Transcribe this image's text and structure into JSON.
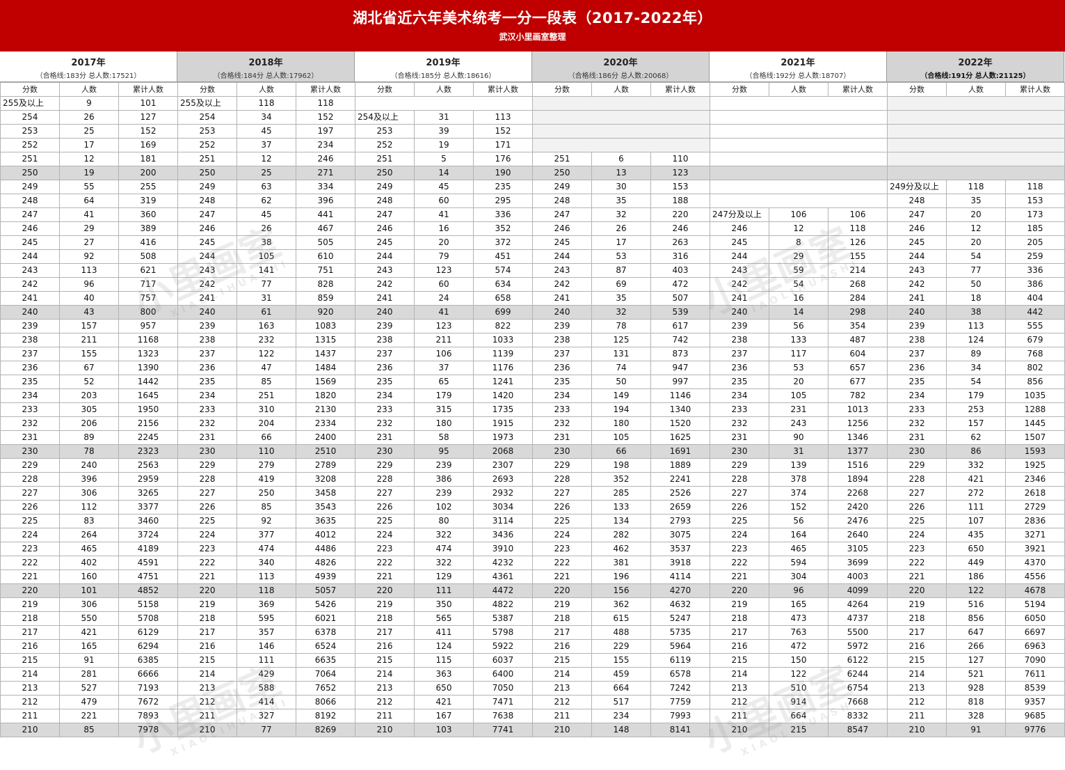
{
  "title": "湖北省近六年美术统考一分一段表（2017-2022年）",
  "subtitle": "武汉小里画室整理",
  "watermark": {
    "main": "小里画室",
    "sub": "XIAOLIHUASHI"
  },
  "years": [
    {
      "year": "2017年",
      "stat": "（合格线:183分 总人数:17521）",
      "grey": false,
      "bold": false
    },
    {
      "year": "2018年",
      "stat": "（合格线:184分 总人数:17962）",
      "grey": true,
      "bold": false
    },
    {
      "year": "2019年",
      "stat": "（合格线:185分 总人数:18616）",
      "grey": false,
      "bold": false
    },
    {
      "year": "2020年",
      "stat": "（合格线:186分 总人数:20068）",
      "grey": true,
      "bold": false
    },
    {
      "year": "2021年",
      "stat": "（合格线:192分 总人数:18707）",
      "grey": false,
      "bold": false
    },
    {
      "year": "2022年",
      "stat": "（合格线:191分 总人数:21125）",
      "grey": true,
      "bold": true
    }
  ],
  "col_headers": [
    "分数",
    "人数",
    "累计人数"
  ],
  "rows": [
    [
      "255及以上",
      "9",
      "101",
      "255及以上",
      "118",
      "118",
      "",
      "",
      "",
      "",
      "",
      "",
      "",
      "",
      "",
      "",
      "",
      ""
    ],
    [
      "254",
      "26",
      "127",
      "254",
      "34",
      "152",
      "254及以上",
      "31",
      "113",
      "",
      "",
      "",
      "",
      "",
      "",
      "",
      "",
      ""
    ],
    [
      "253",
      "25",
      "152",
      "253",
      "45",
      "197",
      "253",
      "39",
      "152",
      "",
      "",
      "",
      "",
      "",
      "",
      "",
      "",
      ""
    ],
    [
      "252",
      "17",
      "169",
      "252",
      "37",
      "234",
      "252",
      "19",
      "171",
      "",
      "",
      "",
      "",
      "",
      "",
      "",
      "",
      ""
    ],
    [
      "251",
      "12",
      "181",
      "251",
      "12",
      "246",
      "251",
      "5",
      "176",
      "251",
      "6",
      "110",
      "",
      "",
      "",
      "",
      "",
      ""
    ],
    [
      "250",
      "19",
      "200",
      "250",
      "25",
      "271",
      "250",
      "14",
      "190",
      "250",
      "13",
      "123",
      "",
      "",
      "",
      "",
      "",
      ""
    ],
    [
      "249",
      "55",
      "255",
      "249",
      "63",
      "334",
      "249",
      "45",
      "235",
      "249",
      "30",
      "153",
      "",
      "",
      "",
      "249分及以上",
      "118",
      "118"
    ],
    [
      "248",
      "64",
      "319",
      "248",
      "62",
      "396",
      "248",
      "60",
      "295",
      "248",
      "35",
      "188",
      "",
      "",
      "",
      "248",
      "35",
      "153"
    ],
    [
      "247",
      "41",
      "360",
      "247",
      "45",
      "441",
      "247",
      "41",
      "336",
      "247",
      "32",
      "220",
      "247分及以上",
      "106",
      "106",
      "247",
      "20",
      "173"
    ],
    [
      "246",
      "29",
      "389",
      "246",
      "26",
      "467",
      "246",
      "16",
      "352",
      "246",
      "26",
      "246",
      "246",
      "12",
      "118",
      "246",
      "12",
      "185"
    ],
    [
      "245",
      "27",
      "416",
      "245",
      "38",
      "505",
      "245",
      "20",
      "372",
      "245",
      "17",
      "263",
      "245",
      "8",
      "126",
      "245",
      "20",
      "205"
    ],
    [
      "244",
      "92",
      "508",
      "244",
      "105",
      "610",
      "244",
      "79",
      "451",
      "244",
      "53",
      "316",
      "244",
      "29",
      "155",
      "244",
      "54",
      "259"
    ],
    [
      "243",
      "113",
      "621",
      "243",
      "141",
      "751",
      "243",
      "123",
      "574",
      "243",
      "87",
      "403",
      "243",
      "59",
      "214",
      "243",
      "77",
      "336"
    ],
    [
      "242",
      "96",
      "717",
      "242",
      "77",
      "828",
      "242",
      "60",
      "634",
      "242",
      "69",
      "472",
      "242",
      "54",
      "268",
      "242",
      "50",
      "386"
    ],
    [
      "241",
      "40",
      "757",
      "241",
      "31",
      "859",
      "241",
      "24",
      "658",
      "241",
      "35",
      "507",
      "241",
      "16",
      "284",
      "241",
      "18",
      "404"
    ],
    [
      "240",
      "43",
      "800",
      "240",
      "61",
      "920",
      "240",
      "41",
      "699",
      "240",
      "32",
      "539",
      "240",
      "14",
      "298",
      "240",
      "38",
      "442"
    ],
    [
      "239",
      "157",
      "957",
      "239",
      "163",
      "1083",
      "239",
      "123",
      "822",
      "239",
      "78",
      "617",
      "239",
      "56",
      "354",
      "239",
      "113",
      "555"
    ],
    [
      "238",
      "211",
      "1168",
      "238",
      "232",
      "1315",
      "238",
      "211",
      "1033",
      "238",
      "125",
      "742",
      "238",
      "133",
      "487",
      "238",
      "124",
      "679"
    ],
    [
      "237",
      "155",
      "1323",
      "237",
      "122",
      "1437",
      "237",
      "106",
      "1139",
      "237",
      "131",
      "873",
      "237",
      "117",
      "604",
      "237",
      "89",
      "768"
    ],
    [
      "236",
      "67",
      "1390",
      "236",
      "47",
      "1484",
      "236",
      "37",
      "1176",
      "236",
      "74",
      "947",
      "236",
      "53",
      "657",
      "236",
      "34",
      "802"
    ],
    [
      "235",
      "52",
      "1442",
      "235",
      "85",
      "1569",
      "235",
      "65",
      "1241",
      "235",
      "50",
      "997",
      "235",
      "20",
      "677",
      "235",
      "54",
      "856"
    ],
    [
      "234",
      "203",
      "1645",
      "234",
      "251",
      "1820",
      "234",
      "179",
      "1420",
      "234",
      "149",
      "1146",
      "234",
      "105",
      "782",
      "234",
      "179",
      "1035"
    ],
    [
      "233",
      "305",
      "1950",
      "233",
      "310",
      "2130",
      "233",
      "315",
      "1735",
      "233",
      "194",
      "1340",
      "233",
      "231",
      "1013",
      "233",
      "253",
      "1288"
    ],
    [
      "232",
      "206",
      "2156",
      "232",
      "204",
      "2334",
      "232",
      "180",
      "1915",
      "232",
      "180",
      "1520",
      "232",
      "243",
      "1256",
      "232",
      "157",
      "1445"
    ],
    [
      "231",
      "89",
      "2245",
      "231",
      "66",
      "2400",
      "231",
      "58",
      "1973",
      "231",
      "105",
      "1625",
      "231",
      "90",
      "1346",
      "231",
      "62",
      "1507"
    ],
    [
      "230",
      "78",
      "2323",
      "230",
      "110",
      "2510",
      "230",
      "95",
      "2068",
      "230",
      "66",
      "1691",
      "230",
      "31",
      "1377",
      "230",
      "86",
      "1593"
    ],
    [
      "229",
      "240",
      "2563",
      "229",
      "279",
      "2789",
      "229",
      "239",
      "2307",
      "229",
      "198",
      "1889",
      "229",
      "139",
      "1516",
      "229",
      "332",
      "1925"
    ],
    [
      "228",
      "396",
      "2959",
      "228",
      "419",
      "3208",
      "228",
      "386",
      "2693",
      "228",
      "352",
      "2241",
      "228",
      "378",
      "1894",
      "228",
      "421",
      "2346"
    ],
    [
      "227",
      "306",
      "3265",
      "227",
      "250",
      "3458",
      "227",
      "239",
      "2932",
      "227",
      "285",
      "2526",
      "227",
      "374",
      "2268",
      "227",
      "272",
      "2618"
    ],
    [
      "226",
      "112",
      "3377",
      "226",
      "85",
      "3543",
      "226",
      "102",
      "3034",
      "226",
      "133",
      "2659",
      "226",
      "152",
      "2420",
      "226",
      "111",
      "2729"
    ],
    [
      "225",
      "83",
      "3460",
      "225",
      "92",
      "3635",
      "225",
      "80",
      "3114",
      "225",
      "134",
      "2793",
      "225",
      "56",
      "2476",
      "225",
      "107",
      "2836"
    ],
    [
      "224",
      "264",
      "3724",
      "224",
      "377",
      "4012",
      "224",
      "322",
      "3436",
      "224",
      "282",
      "3075",
      "224",
      "164",
      "2640",
      "224",
      "435",
      "3271"
    ],
    [
      "223",
      "465",
      "4189",
      "223",
      "474",
      "4486",
      "223",
      "474",
      "3910",
      "223",
      "462",
      "3537",
      "223",
      "465",
      "3105",
      "223",
      "650",
      "3921"
    ],
    [
      "222",
      "402",
      "4591",
      "222",
      "340",
      "4826",
      "222",
      "322",
      "4232",
      "222",
      "381",
      "3918",
      "222",
      "594",
      "3699",
      "222",
      "449",
      "4370"
    ],
    [
      "221",
      "160",
      "4751",
      "221",
      "113",
      "4939",
      "221",
      "129",
      "4361",
      "221",
      "196",
      "4114",
      "221",
      "304",
      "4003",
      "221",
      "186",
      "4556"
    ],
    [
      "220",
      "101",
      "4852",
      "220",
      "118",
      "5057",
      "220",
      "111",
      "4472",
      "220",
      "156",
      "4270",
      "220",
      "96",
      "4099",
      "220",
      "122",
      "4678"
    ],
    [
      "219",
      "306",
      "5158",
      "219",
      "369",
      "5426",
      "219",
      "350",
      "4822",
      "219",
      "362",
      "4632",
      "219",
      "165",
      "4264",
      "219",
      "516",
      "5194"
    ],
    [
      "218",
      "550",
      "5708",
      "218",
      "595",
      "6021",
      "218",
      "565",
      "5387",
      "218",
      "615",
      "5247",
      "218",
      "473",
      "4737",
      "218",
      "856",
      "6050"
    ],
    [
      "217",
      "421",
      "6129",
      "217",
      "357",
      "6378",
      "217",
      "411",
      "5798",
      "217",
      "488",
      "5735",
      "217",
      "763",
      "5500",
      "217",
      "647",
      "6697"
    ],
    [
      "216",
      "165",
      "6294",
      "216",
      "146",
      "6524",
      "216",
      "124",
      "5922",
      "216",
      "229",
      "5964",
      "216",
      "472",
      "5972",
      "216",
      "266",
      "6963"
    ],
    [
      "215",
      "91",
      "6385",
      "215",
      "111",
      "6635",
      "215",
      "115",
      "6037",
      "215",
      "155",
      "6119",
      "215",
      "150",
      "6122",
      "215",
      "127",
      "7090"
    ],
    [
      "214",
      "281",
      "6666",
      "214",
      "429",
      "7064",
      "214",
      "363",
      "6400",
      "214",
      "459",
      "6578",
      "214",
      "122",
      "6244",
      "214",
      "521",
      "7611"
    ],
    [
      "213",
      "527",
      "7193",
      "213",
      "588",
      "7652",
      "213",
      "650",
      "7050",
      "213",
      "664",
      "7242",
      "213",
      "510",
      "6754",
      "213",
      "928",
      "8539"
    ],
    [
      "212",
      "479",
      "7672",
      "212",
      "414",
      "8066",
      "212",
      "421",
      "7471",
      "212",
      "517",
      "7759",
      "212",
      "914",
      "7668",
      "212",
      "818",
      "9357"
    ],
    [
      "211",
      "221",
      "7893",
      "211",
      "327",
      "8192",
      "211",
      "167",
      "7638",
      "211",
      "234",
      "7993",
      "211",
      "664",
      "8332",
      "211",
      "328",
      "9685"
    ],
    [
      "210",
      "85",
      "7978",
      "210",
      "77",
      "8269",
      "210",
      "103",
      "7741",
      "210",
      "148",
      "8141",
      "210",
      "215",
      "8547",
      "210",
      "91",
      "9776"
    ]
  ],
  "colors": {
    "title_bg": "#c00000",
    "row_highlight": "#d9d9d9",
    "header_grey": "#d4d4d4"
  }
}
